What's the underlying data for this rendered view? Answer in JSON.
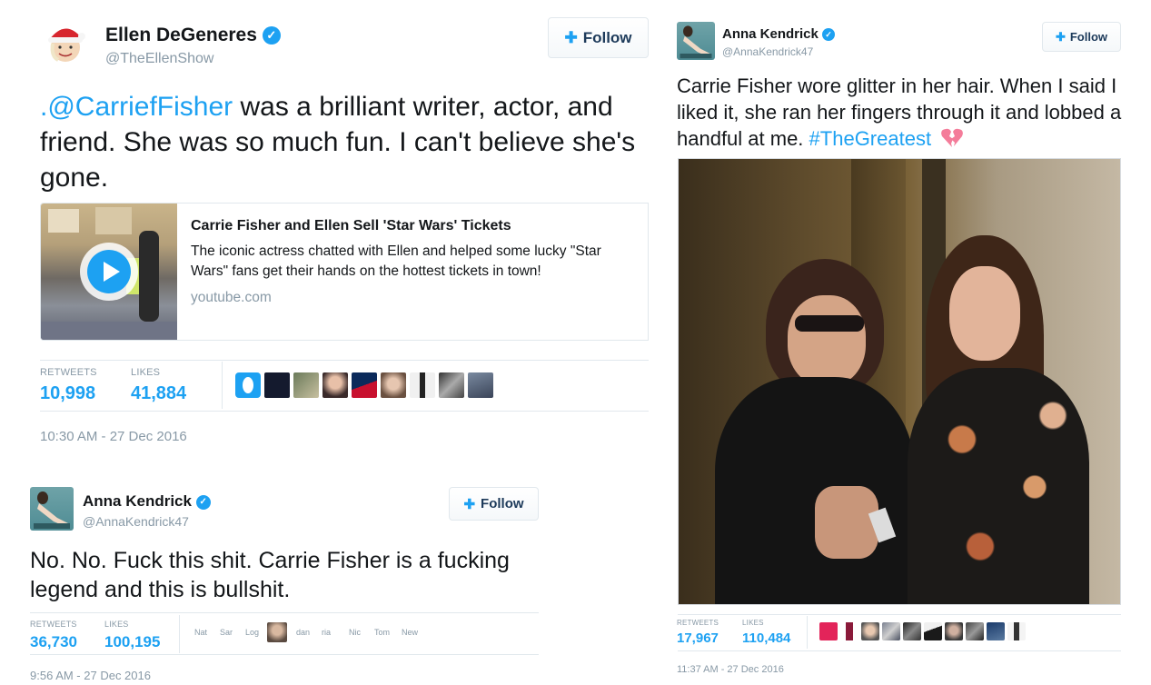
{
  "ellen": {
    "name": "Ellen DeGeneres",
    "handle": "@TheEllenShow",
    "follow_label": "Follow",
    "text_mention": ".@CarriefFisher",
    "text_rest": " was a brilliant writer, actor, and friend. She was so much fun. I can't believe she's gone.",
    "card": {
      "title": "Carrie Fisher and Ellen Sell 'Star Wars' Tickets",
      "description": "The iconic actress chatted with Ellen and helped some lucky \"Star Wars\" fans get their hands on the hottest tickets in town!",
      "domain": "youtube.com"
    },
    "retweets_label": "RETWEETS",
    "retweets": "10,998",
    "likes_label": "LIKES",
    "likes": "41,884",
    "timestamp": "10:30 AM - 27 Dec 2016"
  },
  "anna_left": {
    "name": "Anna Kendrick",
    "handle": "@AnnaKendrick47",
    "follow_label": "Follow",
    "text": "No. No. Fuck this shit. Carrie Fisher is a fucking legend and this is bullshit.",
    "retweets_label": "RETWEETS",
    "retweets": "36,730",
    "likes_label": "LIKES",
    "likes": "100,195",
    "likers": [
      "Nat",
      "Sar",
      "Log",
      "dan",
      "ria",
      "Nic",
      "Tom",
      "New"
    ],
    "timestamp": "9:56 AM - 27 Dec 2016"
  },
  "anna_right": {
    "name": "Anna Kendrick",
    "handle": "@AnnaKendrick47",
    "follow_label": "Follow",
    "text_plain": "Carrie Fisher wore glitter in her hair. When I said I liked it, she ran her fingers through it and lobbed a handful at me. ",
    "hashtag": "#TheGreatest",
    "retweets_label": "RETWEETS",
    "retweets": "17,967",
    "likes_label": "LIKES",
    "likes": "110,484",
    "timestamp": "11:37 AM - 27 Dec 2016"
  },
  "colors": {
    "link": "#1da1f2",
    "muted": "#8899a6",
    "text": "#14171a",
    "border": "#e1e8ed"
  }
}
